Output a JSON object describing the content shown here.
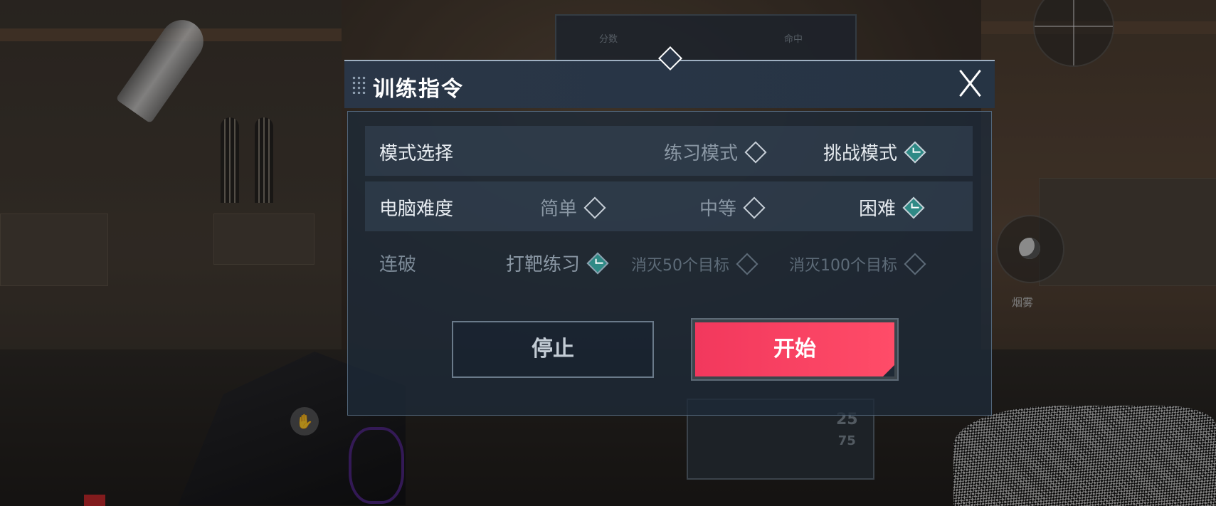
{
  "hud": {
    "scoreboard_left": "分数",
    "scoreboard_right": "命中",
    "ammo_current": "25",
    "ammo_total": "75",
    "smoke_label": "烟雾",
    "hand_icon": "✋"
  },
  "dialog": {
    "title": "训练指令",
    "rows": [
      {
        "label": "模式选择",
        "options": [
          {
            "label": "练习模式",
            "selected": false
          },
          {
            "label": "挑战模式",
            "selected": true
          }
        ]
      },
      {
        "label": "电脑难度",
        "options": [
          {
            "label": "简单",
            "selected": false
          },
          {
            "label": "中等",
            "selected": false
          },
          {
            "label": "困难",
            "selected": true
          }
        ]
      },
      {
        "label": "连破",
        "disabled": true,
        "options": [
          {
            "label": "打靶练习",
            "selected": true
          },
          {
            "label": "消灭50个目标",
            "selected": false
          },
          {
            "label": "消灭100个目标",
            "selected": false
          }
        ]
      }
    ],
    "stop_label": "停止",
    "start_label": "开始"
  },
  "colors": {
    "start_button": "#f2385d",
    "selected_check": "#2f8a86",
    "dialog_header": "#2a3647"
  }
}
